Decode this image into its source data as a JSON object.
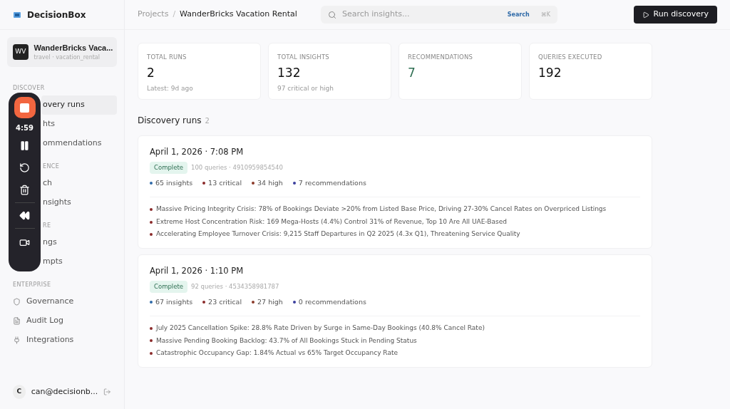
{
  "app": {
    "name": "DecisionBox"
  },
  "project": {
    "initials": "WV",
    "name": "WanderBricks Vaca...",
    "subtitle": "travel · vacation_rental"
  },
  "sidebar": {
    "sections": [
      {
        "label": "DISCOVER",
        "items": [
          {
            "label": "overy runs",
            "selected": true
          },
          {
            "label": "hts",
            "selected": false
          },
          {
            "label": "ommendations",
            "selected": false
          }
        ]
      },
      {
        "label": "ENCE",
        "items": [
          {
            "label": "ch",
            "selected": false
          },
          {
            "label": "nsights",
            "selected": false
          }
        ]
      },
      {
        "label": "RE",
        "items": [
          {
            "label": "ngs",
            "selected": false
          },
          {
            "label": "mpts",
            "selected": false
          }
        ]
      },
      {
        "label": "ENTERPRISE",
        "items": [
          {
            "label": "Governance",
            "kind": "icon",
            "selected": false
          },
          {
            "label": "Audit Log",
            "kind": "icon",
            "selected": false
          },
          {
            "label": "Integrations",
            "kind": "icon",
            "selected": false
          }
        ]
      }
    ],
    "user": {
      "initial": "C",
      "email": "can@decisionb..."
    }
  },
  "recorder": {
    "time": "4:59"
  },
  "breadcrumb": {
    "parent": "Projects",
    "separator": "/",
    "current": "WanderBricks Vacation Rental"
  },
  "search": {
    "placeholder": "Search insights...",
    "button": "Search",
    "shortcut": "⌘K"
  },
  "run_button": "Run discovery",
  "stats": [
    {
      "label": "TOTAL RUNS",
      "value": "2",
      "note": "Latest: 9d ago",
      "accent": false
    },
    {
      "label": "TOTAL INSIGHTS",
      "value": "132",
      "note": "97 critical or high",
      "accent": false
    },
    {
      "label": "RECOMMENDATIONS",
      "value": "7",
      "accent": true
    },
    {
      "label": "QUERIES EXECUTED",
      "value": "192",
      "accent": false
    }
  ],
  "runs_section": {
    "title": "Discovery runs",
    "count": "2"
  },
  "runs": [
    {
      "date": "April 1, 2026 · 7:08 PM",
      "status": "Complete",
      "meta": "100 queries · 4910959854540",
      "counts": [
        {
          "text": "65 insights",
          "color": "#2f6aa8"
        },
        {
          "text": "13 critical",
          "color": "#8b2a2a"
        },
        {
          "text": "34 high",
          "color": "#8b3a2a"
        },
        {
          "text": "7 recommendations",
          "color": "#3b3f9e"
        }
      ],
      "insights": [
        "Massive Pricing Integrity Crisis: 78% of Bookings Deviate >20% from Listed Base Price, Driving 27-30% Cancel Rates on Overpriced Listings",
        "Extreme Host Concentration Risk: 169 Mega-Hosts (4.4%) Control 31% of Revenue, Top 10 Are All UAE-Based",
        "Accelerating Employee Turnover Crisis: 9,215 Staff Departures in Q2 2025 (4.3x Q1), Threatening Service Quality"
      ]
    },
    {
      "date": "April 1, 2026 · 1:10 PM",
      "status": "Complete",
      "meta": "92 queries · 4534358981787",
      "counts": [
        {
          "text": "67 insights",
          "color": "#2f6aa8"
        },
        {
          "text": "23 critical",
          "color": "#8b2a2a"
        },
        {
          "text": "27 high",
          "color": "#8b3a2a"
        },
        {
          "text": "0 recommendations",
          "color": "#3b3f9e"
        }
      ],
      "insights": [
        "July 2025 Cancellation Spike: 28.8% Rate Driven by Surge in Same-Day Bookings (40.8% Cancel Rate)",
        "Massive Pending Booking Backlog: 43.7% of All Bookings Stuck in Pending Status",
        "Catastrophic Occupancy Gap: 1.84% Actual vs 65% Target Occupancy Rate"
      ]
    }
  ]
}
